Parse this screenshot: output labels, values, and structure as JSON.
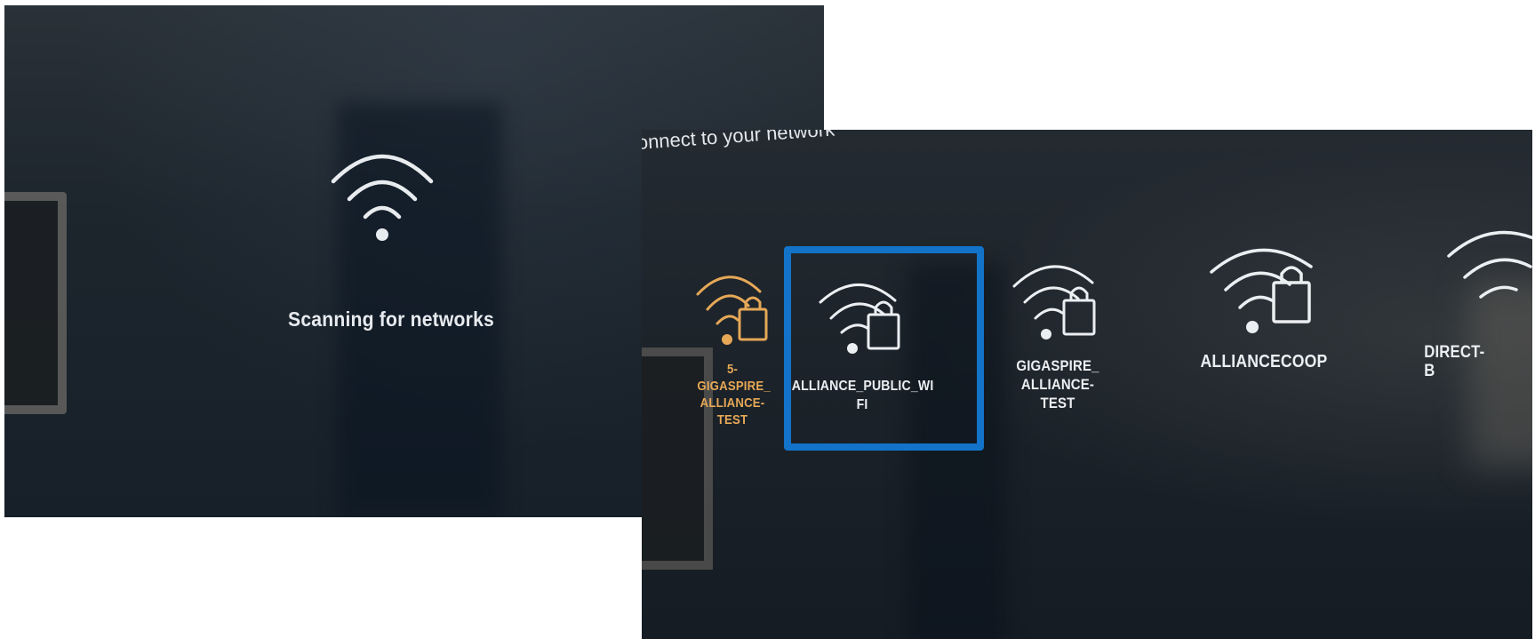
{
  "scanning_screen": {
    "icon": "wifi-icon",
    "message": "Scanning for networks"
  },
  "network_screen": {
    "heading": "onnect to your network",
    "networks": [
      {
        "name": "5-GIGASPIRE_ ALLIANCE- TEST",
        "icon": "wifi-locked-icon",
        "state": "highlighted",
        "color": "#e6a857"
      },
      {
        "name": "ALLIANCE_PUBLIC_WI FI",
        "icon": "wifi-locked-icon",
        "state": "focused",
        "color": "#eceff2"
      },
      {
        "name": "GIGASPIRE_ ALLIANCE- TEST",
        "icon": "wifi-locked-icon",
        "state": "normal",
        "color": "#eceff2"
      },
      {
        "name": "ALLIANCECOOP",
        "icon": "wifi-locked-icon",
        "state": "normal",
        "color": "#eceff2"
      },
      {
        "name": "DIRECT- B",
        "icon": "wifi-icon",
        "state": "normal",
        "color": "#eceff2"
      }
    ],
    "focus_color": "#1273c9"
  }
}
